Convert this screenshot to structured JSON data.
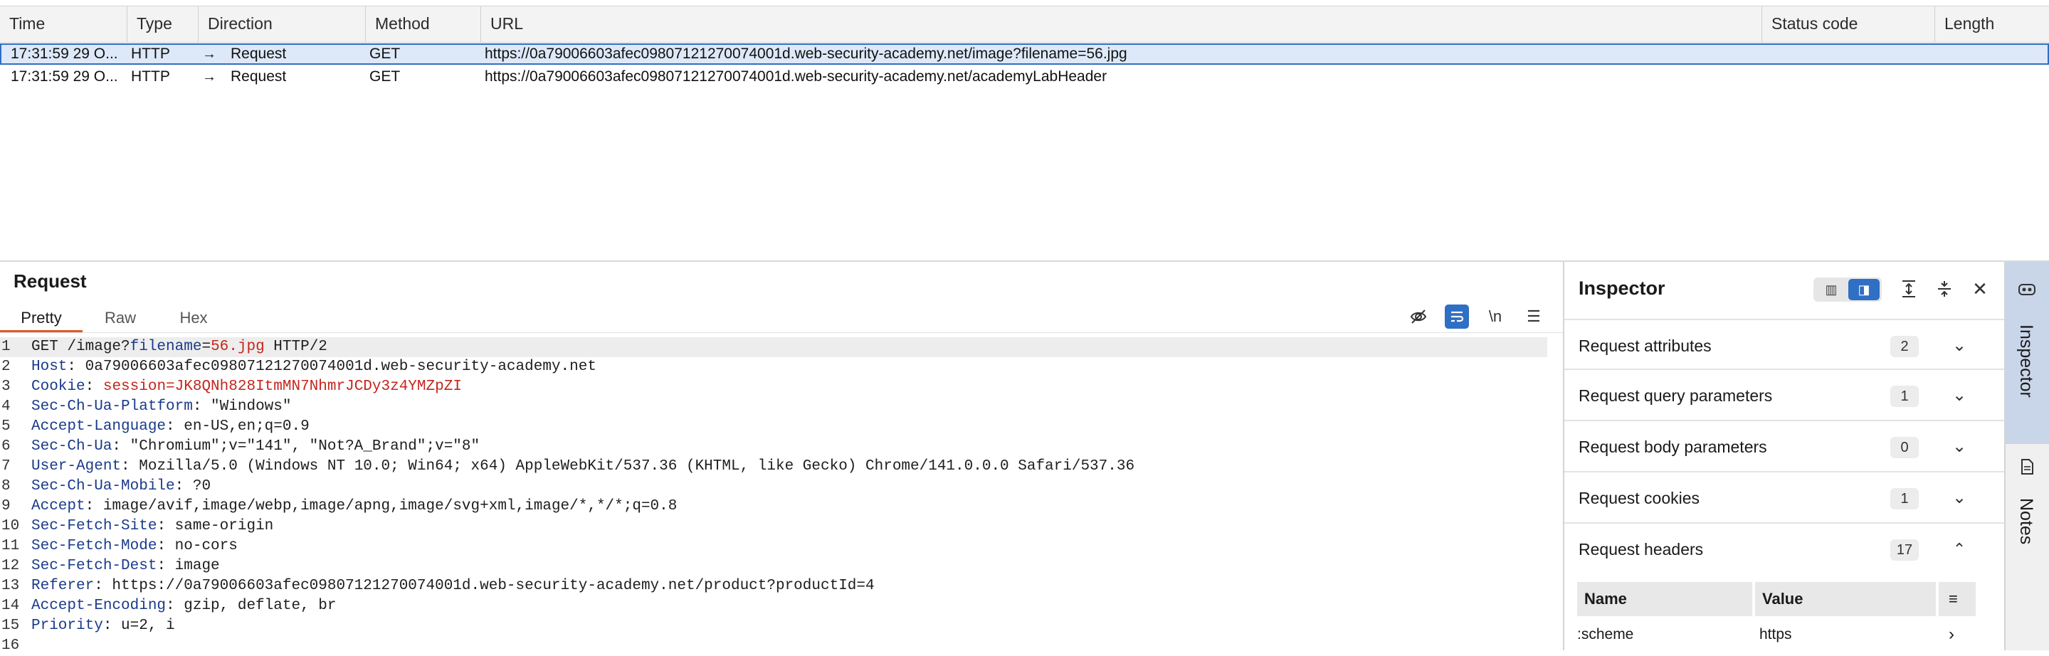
{
  "history": {
    "columns": [
      "Time",
      "Type",
      "Direction",
      "Method",
      "URL",
      "Status code",
      "Length"
    ],
    "rows": [
      {
        "time": "17:31:59 29 O...",
        "type": "HTTP",
        "direction": "Request",
        "method": "GET",
        "url": "https://0a79006603afec09807121270074001d.web-security-academy.net/image?filename=56.jpg",
        "status": "",
        "length": ""
      },
      {
        "time": "17:31:59 29 O...",
        "type": "HTTP",
        "direction": "Request",
        "method": "GET",
        "url": "https://0a79006603afec09807121270074001d.web-security-academy.net/academyLabHeader",
        "status": "",
        "length": ""
      }
    ],
    "direction_arrow": "→"
  },
  "request": {
    "title": "Request",
    "tabs": [
      "Pretty",
      "Raw",
      "Hex"
    ],
    "active_tab": "Pretty",
    "newline_toggle": "\\n",
    "request_line": {
      "method_path": "GET /image?",
      "param_name": "filename",
      "eq": "=",
      "param_value": "56.jpg",
      "version": " HTTP/2"
    },
    "headers": [
      {
        "name": "Host",
        "value": " 0a79006603afec09807121270074001d.web-security-academy.net"
      },
      {
        "name": "Cookie",
        "value": " session=JK8QNh828ItmMN7NhmrJCDy3z4YMZpZI",
        "is_cookie": true
      },
      {
        "name": "Sec-Ch-Ua-Platform",
        "value": " \"Windows\""
      },
      {
        "name": "Accept-Language",
        "value": " en-US,en;q=0.9"
      },
      {
        "name": "Sec-Ch-Ua",
        "value": " \"Chromium\";v=\"141\", \"Not?A_Brand\";v=\"8\""
      },
      {
        "name": "User-Agent",
        "value": " Mozilla/5.0 (Windows NT 10.0; Win64; x64) AppleWebKit/537.36 (KHTML, like Gecko) Chrome/141.0.0.0 Safari/537.36"
      },
      {
        "name": "Sec-Ch-Ua-Mobile",
        "value": " ?0"
      },
      {
        "name": "Accept",
        "value": " image/avif,image/webp,image/apng,image/svg+xml,image/*,*/*;q=0.8"
      },
      {
        "name": "Sec-Fetch-Site",
        "value": " same-origin"
      },
      {
        "name": "Sec-Fetch-Mode",
        "value": " no-cors"
      },
      {
        "name": "Sec-Fetch-Dest",
        "value": " image"
      },
      {
        "name": "Referer",
        "value": " https://0a79006603afec09807121270074001d.web-security-academy.net/product?productId=4"
      },
      {
        "name": "Accept-Encoding",
        "value": " gzip, deflate, br"
      },
      {
        "name": "Priority",
        "value": " u=2, i"
      }
    ],
    "last_line_number": "16"
  },
  "inspector": {
    "title": "Inspector",
    "sections": [
      {
        "label": "Request attributes",
        "count": "2",
        "expanded": false
      },
      {
        "label": "Request query parameters",
        "count": "1",
        "expanded": false
      },
      {
        "label": "Request body parameters",
        "count": "0",
        "expanded": false
      },
      {
        "label": "Request cookies",
        "count": "1",
        "expanded": false
      },
      {
        "label": "Request headers",
        "count": "17",
        "expanded": true
      }
    ],
    "headers_table": {
      "name_col": "Name",
      "value_col": "Value",
      "first_row": {
        "name": ":scheme",
        "value": "https"
      }
    }
  },
  "side_rail": {
    "tabs": [
      "Inspector",
      "Notes"
    ],
    "active": "Inspector"
  },
  "colors": {
    "accent_blue": "#2f6fc4",
    "tab_underline": "#e0591e",
    "selected_row": "#dde8f8",
    "header_name": "#1a3a8a",
    "param_value": "#c3261d"
  }
}
